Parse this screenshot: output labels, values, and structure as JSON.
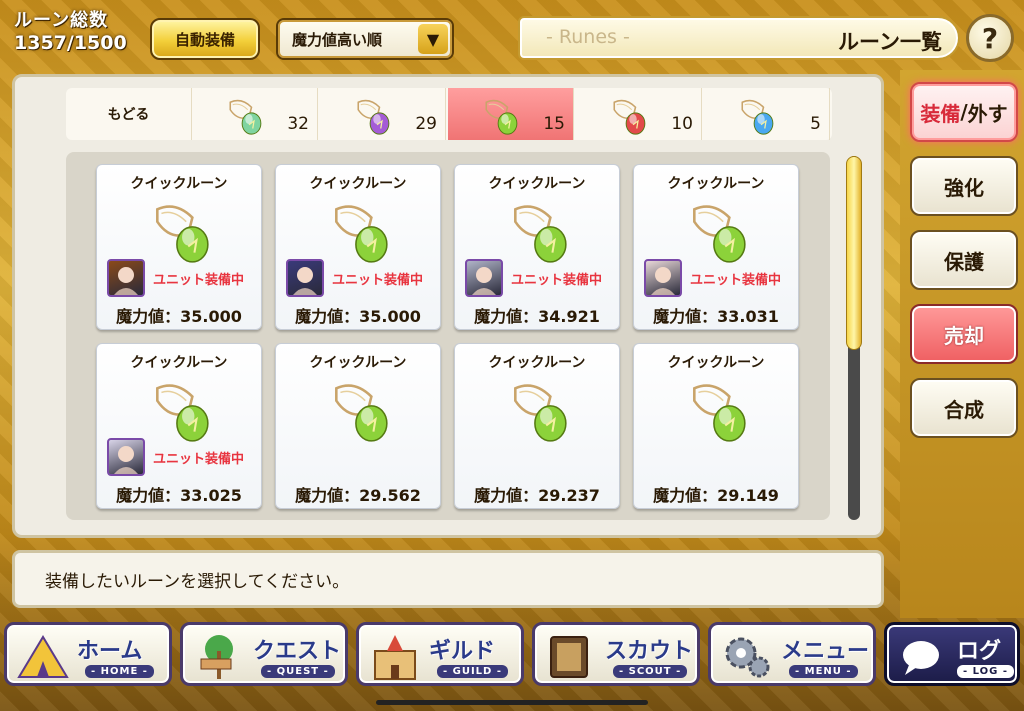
{
  "header": {
    "count_label": "ルーン総数",
    "count_value": "1357/1500",
    "auto_equip_label": "自動装備",
    "sort_label": "魔力値高い順",
    "title_sub": "- Runes -",
    "title_main": "ルーン一覧",
    "help_label": "?"
  },
  "tabs": {
    "back_label": "もどる",
    "items": [
      {
        "count": "32",
        "gem_color": "#7fd4a0",
        "selected": false
      },
      {
        "count": "29",
        "gem_color": "#a45cd6",
        "selected": false
      },
      {
        "count": "15",
        "gem_color": "#8cd23a",
        "selected": true
      },
      {
        "count": "10",
        "gem_color": "#e24a4a",
        "selected": false
      },
      {
        "count": "5",
        "gem_color": "#4aa8f0",
        "selected": false
      }
    ]
  },
  "side": {
    "equip_a": "装備",
    "equip_sep": "/",
    "equip_b": "外す",
    "enhance": "強化",
    "protect": "保護",
    "sell": "売却",
    "synth": "合成"
  },
  "cards": [
    {
      "name": "クイックルーン",
      "equipped": "ユニット装備中",
      "power": "魔力値：35.000",
      "portrait": "#8a4a1a"
    },
    {
      "name": "クイックルーン",
      "equipped": "ユニット装備中",
      "power": "魔力値：35.000",
      "portrait": "#3a3a7a"
    },
    {
      "name": "クイックルーン",
      "equipped": "ユニット装備中",
      "power": "魔力値：34.921",
      "portrait": "#b0b4c8"
    },
    {
      "name": "クイックルーン",
      "equipped": "ユニット装備中",
      "power": "魔力値：33.031",
      "portrait": "#e8d8d8"
    },
    {
      "name": "クイックルーン",
      "equipped": "ユニット装備中",
      "power": "魔力値：33.025",
      "portrait": "#d8d4e8"
    },
    {
      "name": "クイックルーン",
      "equipped": "",
      "power": "魔力値：29.562",
      "portrait": ""
    },
    {
      "name": "クイックルーン",
      "equipped": "",
      "power": "魔力値：29.237",
      "portrait": ""
    },
    {
      "name": "クイックルーン",
      "equipped": "",
      "power": "魔力値：29.149",
      "portrait": ""
    }
  ],
  "message": "装備したいルーンを選択してください。",
  "nav": [
    {
      "jp": "ホーム",
      "en": "HOME",
      "icon": "home-tent-icon"
    },
    {
      "jp": "クエスト",
      "en": "QUEST",
      "icon": "quest-signpost-icon"
    },
    {
      "jp": "ギルド",
      "en": "GUILD",
      "icon": "guild-castle-icon"
    },
    {
      "jp": "スカウト",
      "en": "SCOUT",
      "icon": "scout-book-icon"
    },
    {
      "jp": "メニュー",
      "en": "MENU",
      "icon": "menu-gear-icon"
    },
    {
      "jp": "ログ",
      "en": "LOG",
      "icon": "log-chat-icon"
    }
  ],
  "colors": {
    "accent_gold": "#e0b33a",
    "selected_tab": "#f07474",
    "equipped_red": "#e8343f",
    "rune_green": "#8cd23a"
  }
}
